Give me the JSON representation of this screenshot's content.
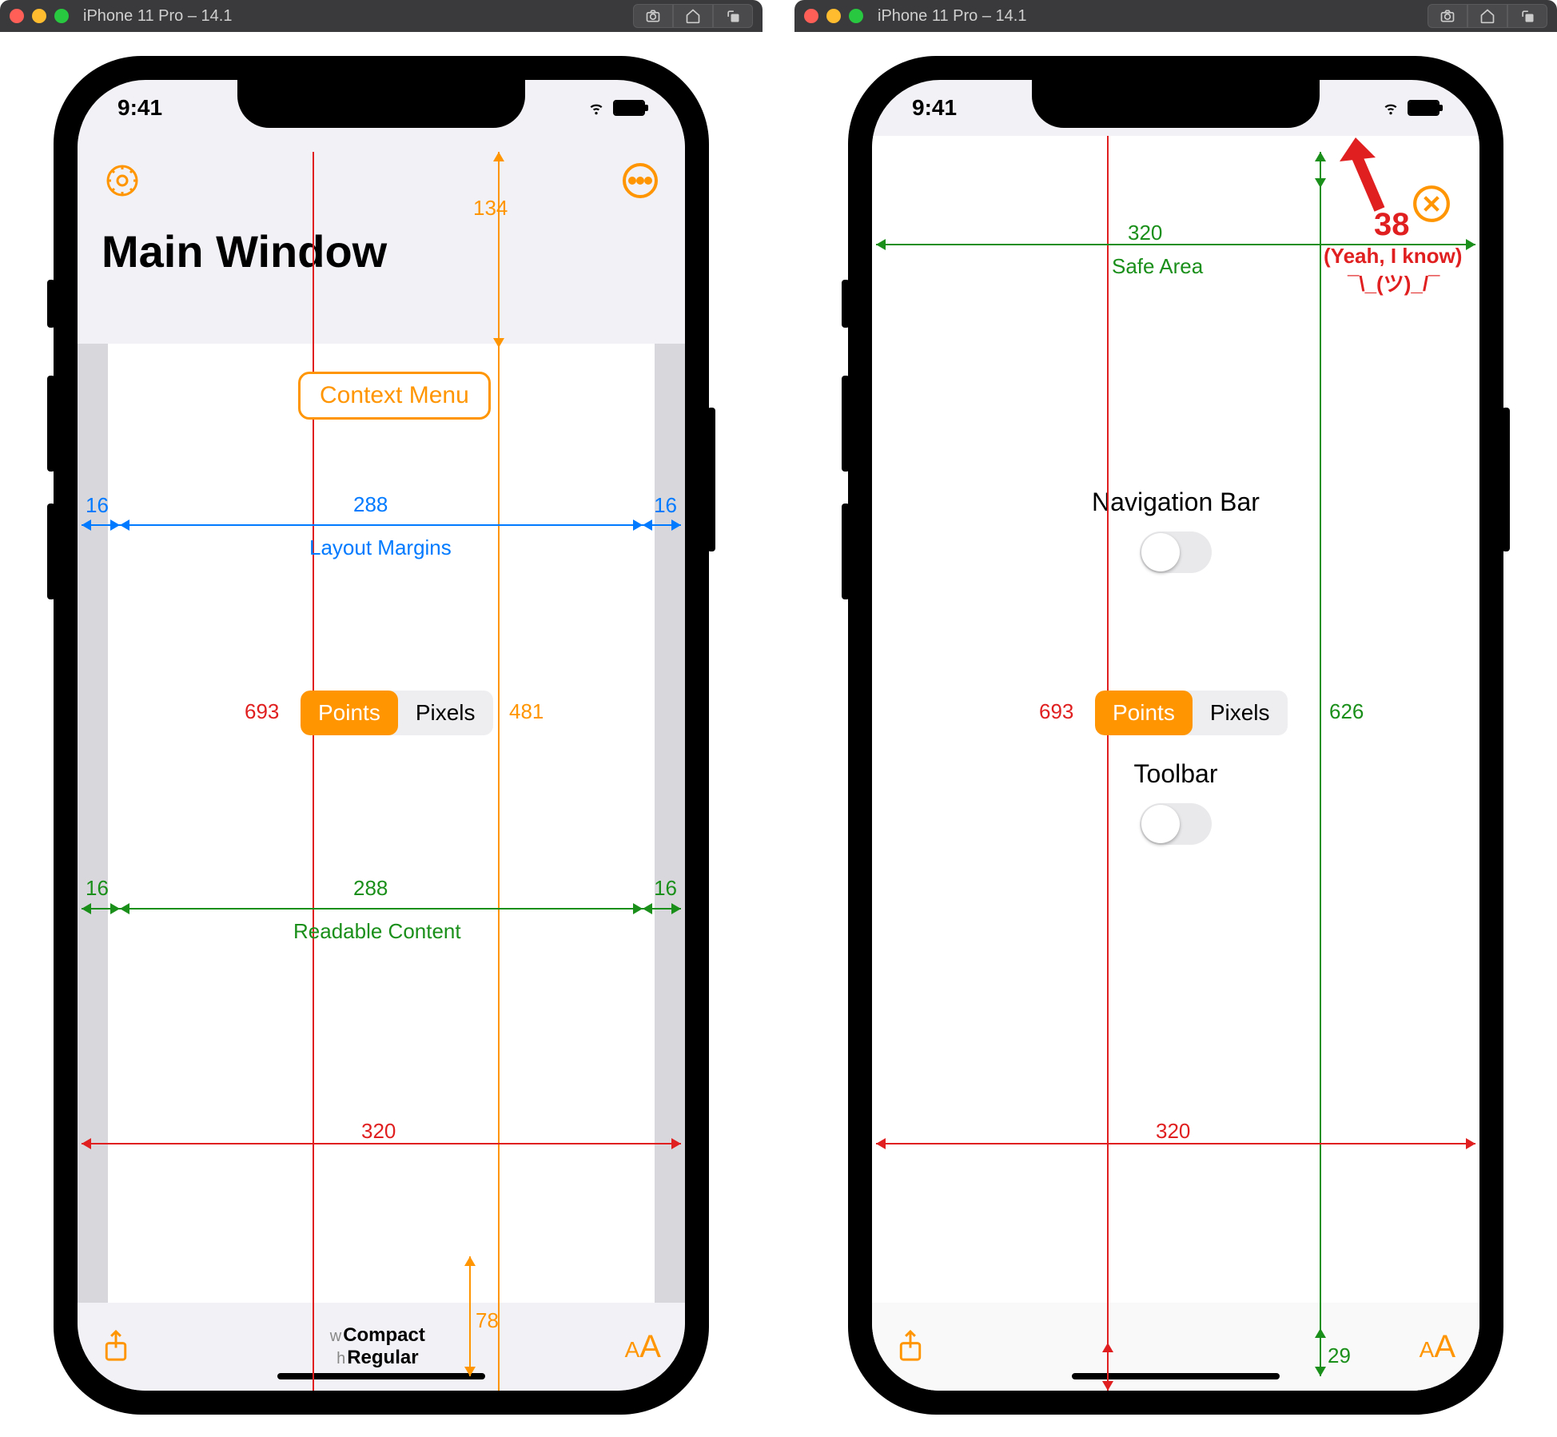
{
  "simulator": {
    "device_title": "iPhone 11 Pro – 14.1",
    "status_time": "9:41"
  },
  "left": {
    "title": "Main Window",
    "top_offset": "134",
    "context_menu_label": "Context Menu",
    "margin_left": "16",
    "margin_right": "16",
    "layout_margins_width": "288",
    "layout_margins_label": "Layout Margins",
    "height_red": "693",
    "seg_points": "Points",
    "seg_pixels": "Pixels",
    "height_orange": "481",
    "readable_left": "16",
    "readable_right": "16",
    "readable_width": "288",
    "readable_label": "Readable Content",
    "full_width": "320",
    "size_class_w_prefix": "w",
    "size_class_w": "Compact",
    "size_class_h_prefix": "h",
    "size_class_h": "Regular",
    "bottom_offset": "78"
  },
  "right": {
    "safe_area_width": "320",
    "safe_area_label": "Safe Area",
    "top_annotation_value": "38",
    "top_annotation_note1": "(Yeah, I know)",
    "top_annotation_note2": "¯\\_(ツ)_/¯",
    "nav_bar_label": "Navigation Bar",
    "height_red": "693",
    "seg_points": "Points",
    "seg_pixels": "Pixels",
    "height_green": "626",
    "toolbar_label": "Toolbar",
    "full_width": "320",
    "bottom_green": "29"
  }
}
